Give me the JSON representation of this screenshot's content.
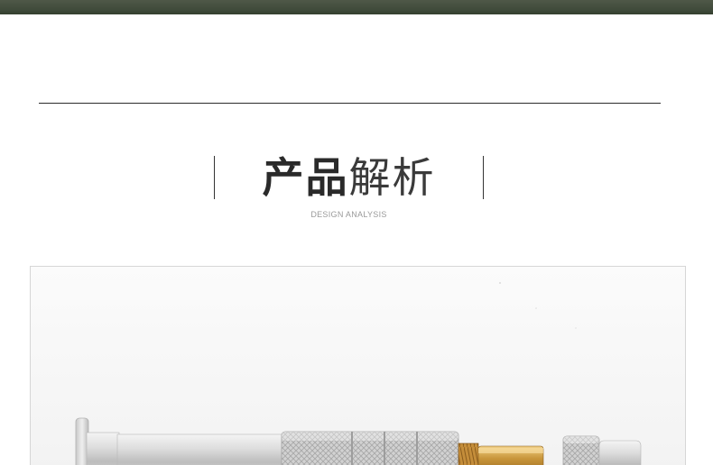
{
  "header": {
    "title_bold": "产品",
    "title_light": "解析",
    "subtitle": "DESIGN ANALYSIS"
  },
  "photo": {
    "icon": "screwdriver-product-photo"
  },
  "colors": {
    "top_band": "#3f4a3a",
    "divider": "#2b2b2b",
    "title_text": "#2a2a2a",
    "subtitle_text": "#9a9a9a",
    "photo_border": "#d6d6d6",
    "brass_tip": "#c8953a"
  }
}
